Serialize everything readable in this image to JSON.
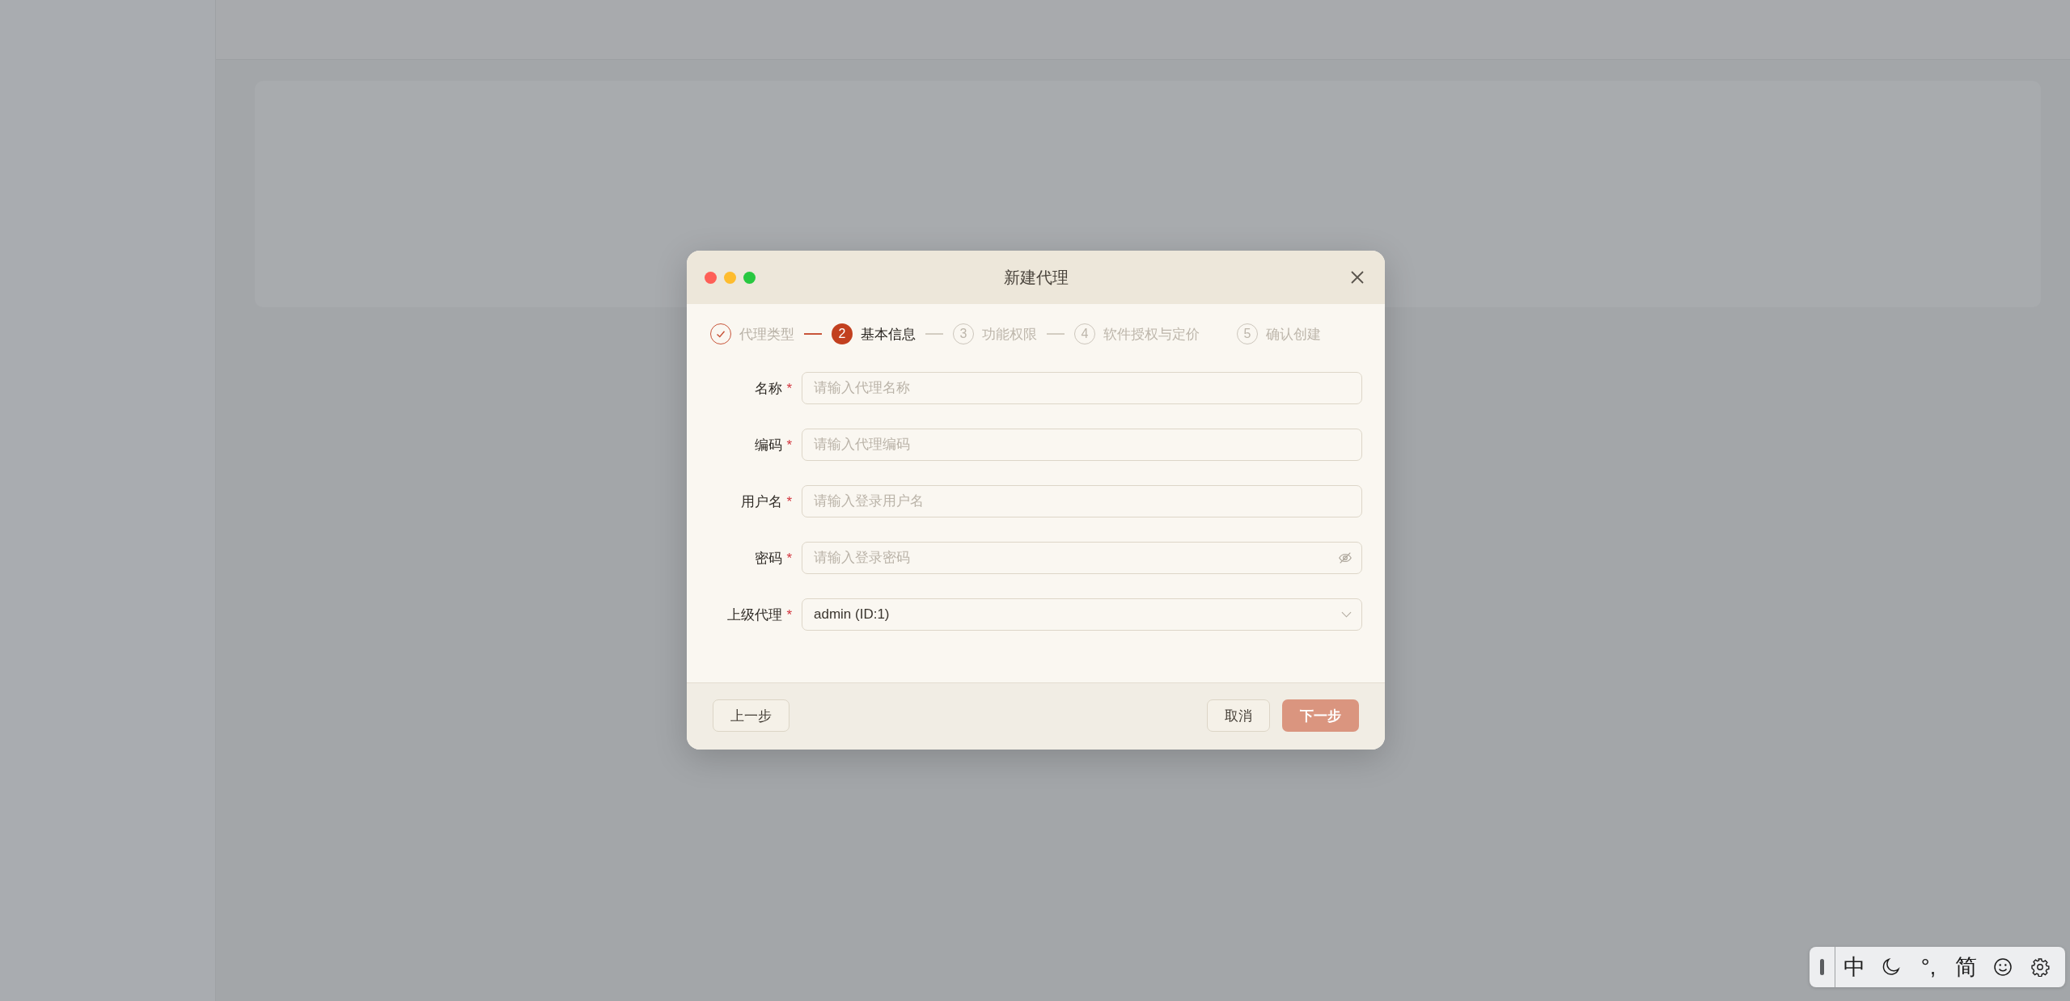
{
  "dialog": {
    "title": "新建代理",
    "steps": [
      {
        "label": "代理类型",
        "kind": "done",
        "connector": true
      },
      {
        "number": "2",
        "label": "基本信息",
        "kind": "active",
        "connector": true
      },
      {
        "number": "3",
        "label": "功能权限",
        "kind": "pending",
        "connector": true
      },
      {
        "number": "4",
        "label": "软件授权与定价",
        "kind": "pending"
      },
      {
        "number": "5",
        "label": "确认创建",
        "kind": "pending"
      }
    ],
    "fields": [
      {
        "kind": "text",
        "label": "名称",
        "required_mark": "*",
        "placeholder": "请输入代理名称"
      },
      {
        "kind": "text",
        "label": "编码",
        "required_mark": "*",
        "placeholder": "请输入代理编码"
      },
      {
        "kind": "text",
        "label": "用户名",
        "required_mark": "*",
        "placeholder": "请输入登录用户名"
      },
      {
        "kind": "password",
        "label": "密码",
        "required_mark": "*",
        "placeholder": "请输入登录密码"
      },
      {
        "kind": "select",
        "label": "上级代理",
        "required_mark": "*",
        "value": "admin (ID:1)"
      }
    ],
    "buttons": {
      "back": "上一步",
      "cancel": "取消",
      "next": "下一步"
    }
  },
  "ime_toolbar": {
    "mode": "中",
    "punctuation": "°,",
    "script": "简"
  }
}
